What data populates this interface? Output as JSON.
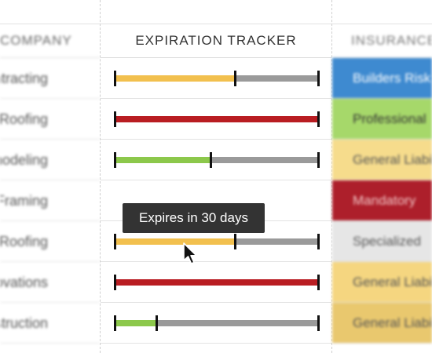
{
  "headers": {
    "company": "COMPANY",
    "tracker": "EXPIRATION TRACKER",
    "insurance": "INSURANCE"
  },
  "colors": {
    "red": "#b91d22",
    "yellow": "#f2c04e",
    "green": "#8cc84b",
    "gray": "#9a9a9a",
    "tooltip_bg": "#333333"
  },
  "rows": [
    {
      "company": "Contracting",
      "status": "yellow",
      "progress": 0.59,
      "insurance": "Builders Risk",
      "ins_bg": "#3e8ad0",
      "ins_fg": "#ffffff"
    },
    {
      "company": "Roofing",
      "status": "red",
      "progress": 1.0,
      "insurance": "Professional",
      "ins_bg": "#a6d86a",
      "ins_fg": "#333333"
    },
    {
      "company": "Remodeling",
      "status": "green",
      "progress": 0.47,
      "insurance": "General Liability",
      "ins_bg": "#f6dc8c",
      "ins_fg": "#555555"
    },
    {
      "company": "Framing",
      "status": "none",
      "progress": 0,
      "insurance": "Mandatory",
      "ins_bg": "#ad1f2b",
      "ins_fg": "#f2c7c7"
    },
    {
      "company": "Roofing",
      "status": "yellow",
      "progress": 0.59,
      "insurance": "Specialized",
      "ins_bg": "#e6e6e6",
      "ins_fg": "#555555"
    },
    {
      "company": "Renovations",
      "status": "red",
      "progress": 1.0,
      "insurance": "General Liability",
      "ins_bg": "#f5d680",
      "ins_fg": "#555555"
    },
    {
      "company": "Construction",
      "status": "green",
      "progress": 0.2,
      "insurance": "General Liability",
      "ins_bg": "#e9c86e",
      "ins_fg": "#555555"
    }
  ],
  "tooltip": {
    "text": "Expires in 30 days"
  }
}
